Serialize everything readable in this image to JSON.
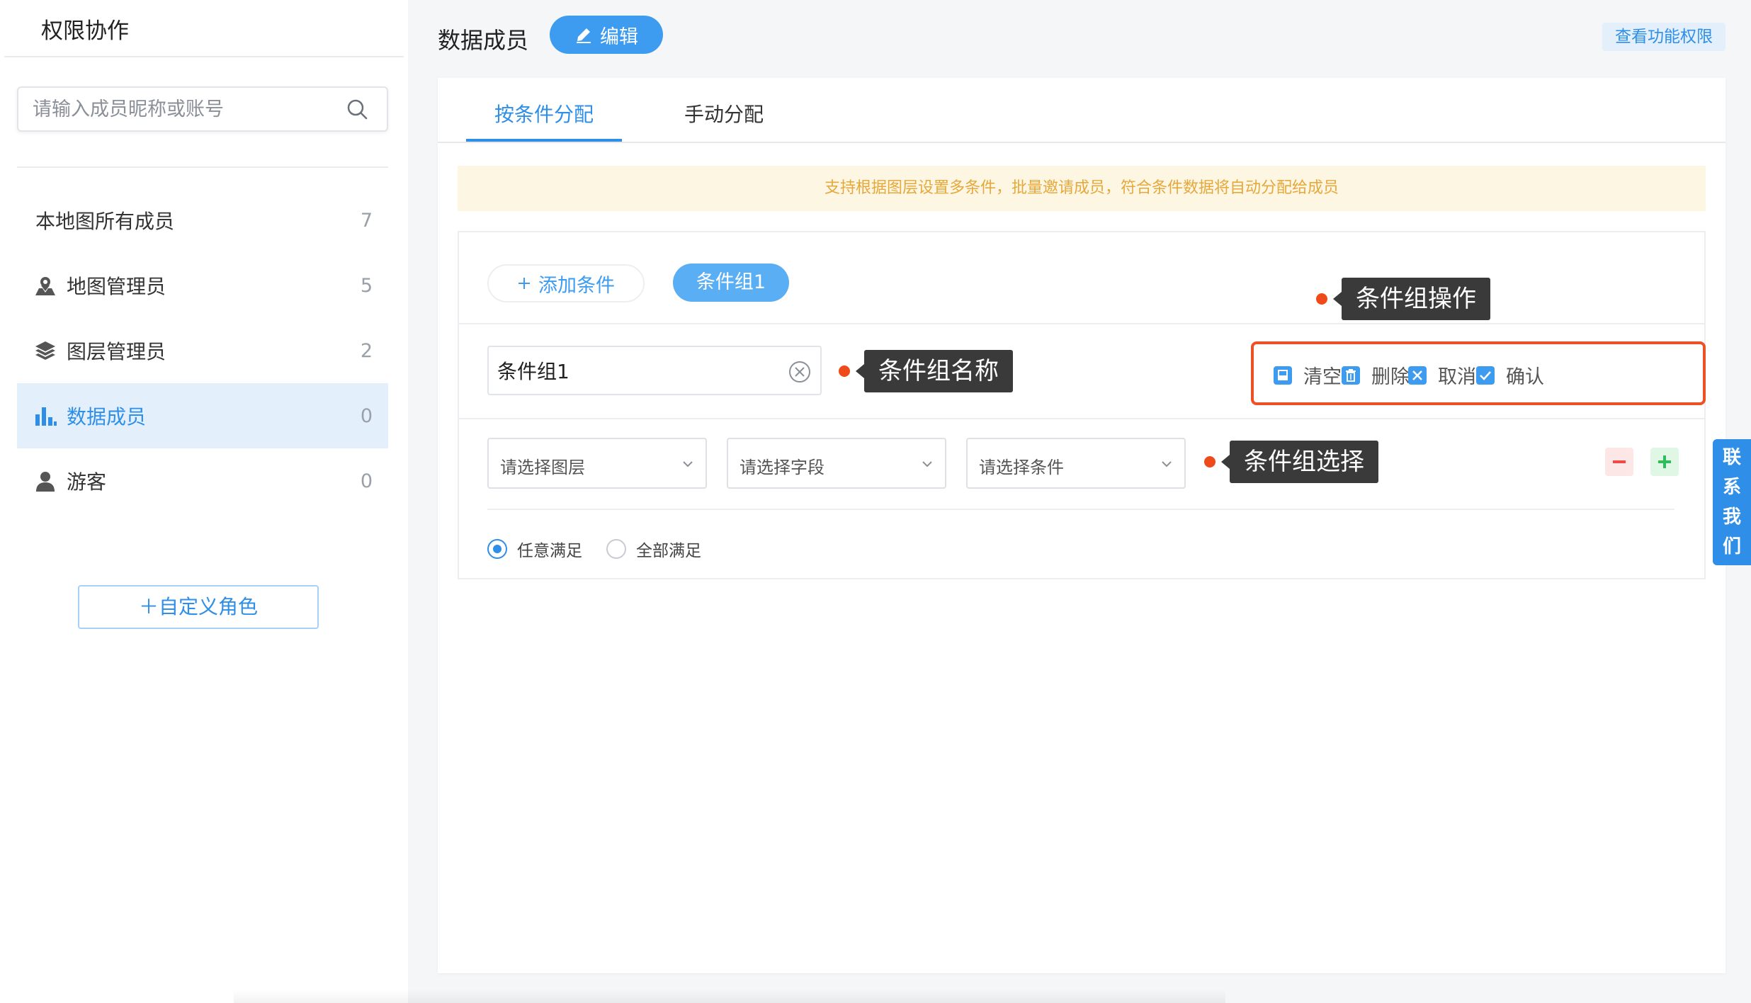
{
  "sidebar": {
    "title": "权限协作",
    "search_placeholder": "请输入成员昵称或账号",
    "roles": [
      {
        "label": "本地图所有成员",
        "count": "7",
        "icon": "none"
      },
      {
        "label": "地图管理员",
        "count": "5",
        "icon": "map-admin-icon"
      },
      {
        "label": "图层管理员",
        "count": "2",
        "icon": "layers-icon"
      },
      {
        "label": "数据成员",
        "count": "0",
        "icon": "bar-chart-icon",
        "active": true
      },
      {
        "label": "游客",
        "count": "0",
        "icon": "user-icon"
      }
    ],
    "custom_role_label": "＋自定义角色"
  },
  "header": {
    "title": "数据成员",
    "edit_label": "编辑",
    "view_permissions_label": "查看功能权限"
  },
  "tabs": [
    {
      "label": "按条件分配",
      "active": true
    },
    {
      "label": "手动分配",
      "active": false
    }
  ],
  "notice": "支持根据图层设置多条件，批量邀请成员，符合条件数据将自动分配给成员",
  "conditions": {
    "add_label": "添加条件",
    "group_tab_label": "条件组1",
    "group_name_value": "条件组1",
    "ops": {
      "clear": "清空",
      "delete": "删除",
      "cancel": "取消",
      "confirm": "确认"
    },
    "selects": {
      "layer_placeholder": "请选择图层",
      "field_placeholder": "请选择字段",
      "condition_placeholder": "请选择条件"
    },
    "match": {
      "any_label": "任意满足",
      "all_label": "全部满足",
      "selected": "any"
    }
  },
  "annotations": {
    "group_ops": "条件组操作",
    "group_name": "条件组名称",
    "group_select": "条件组选择"
  },
  "contact_us": [
    "联",
    "系",
    "我",
    "们"
  ],
  "colors": {
    "accent": "#2f8fe8",
    "annotation_red": "#ee5125",
    "notice_bg": "#fdf6e3",
    "notice_text": "#e5a83a"
  }
}
